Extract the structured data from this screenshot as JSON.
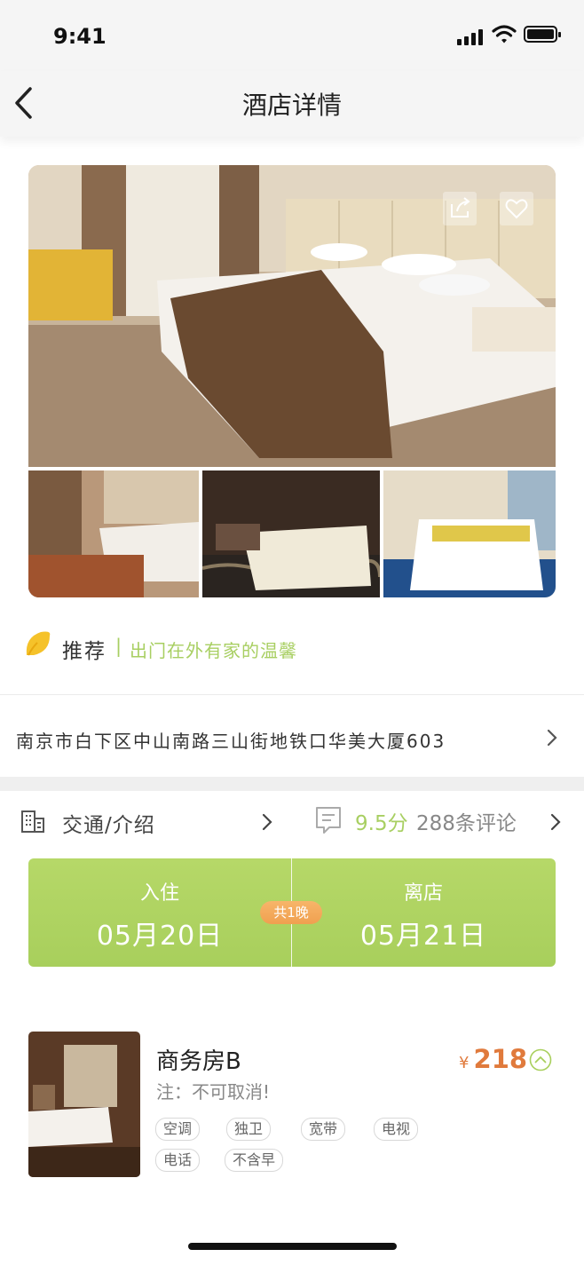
{
  "status_bar": {
    "time": "9:41"
  },
  "nav": {
    "title": "酒店详情"
  },
  "recommend": {
    "label": "推荐",
    "separator": "|",
    "slogan": "出门在外有家的温馨"
  },
  "address": "南京市白下区中山南路三山街地铁口华美大厦603",
  "info": {
    "intro_label": "交通/介绍",
    "score": "9.5分",
    "reviews": "288条评论"
  },
  "dates": {
    "checkin_label": "入住",
    "checkin_date": "05月20日",
    "checkout_label": "离店",
    "checkout_date": "05月21日",
    "nights": "共1晚"
  },
  "room": {
    "name": "商务房B",
    "note": "注：不可取消!",
    "currency": "¥",
    "price": "218",
    "amenities": [
      "空调",
      "独卫",
      "宽带",
      "电视",
      "电话",
      "不含早"
    ]
  },
  "colors": {
    "accent_green": "#a8cf5c",
    "price_orange": "#e07a3c",
    "nights_badge": "#f0a050"
  },
  "icons": [
    "back-arrow-icon",
    "share-icon",
    "heart-icon",
    "recommend-leaf-icon",
    "chevron-right-icon",
    "building-icon",
    "comment-icon",
    "chevron-up-circle-icon"
  ]
}
